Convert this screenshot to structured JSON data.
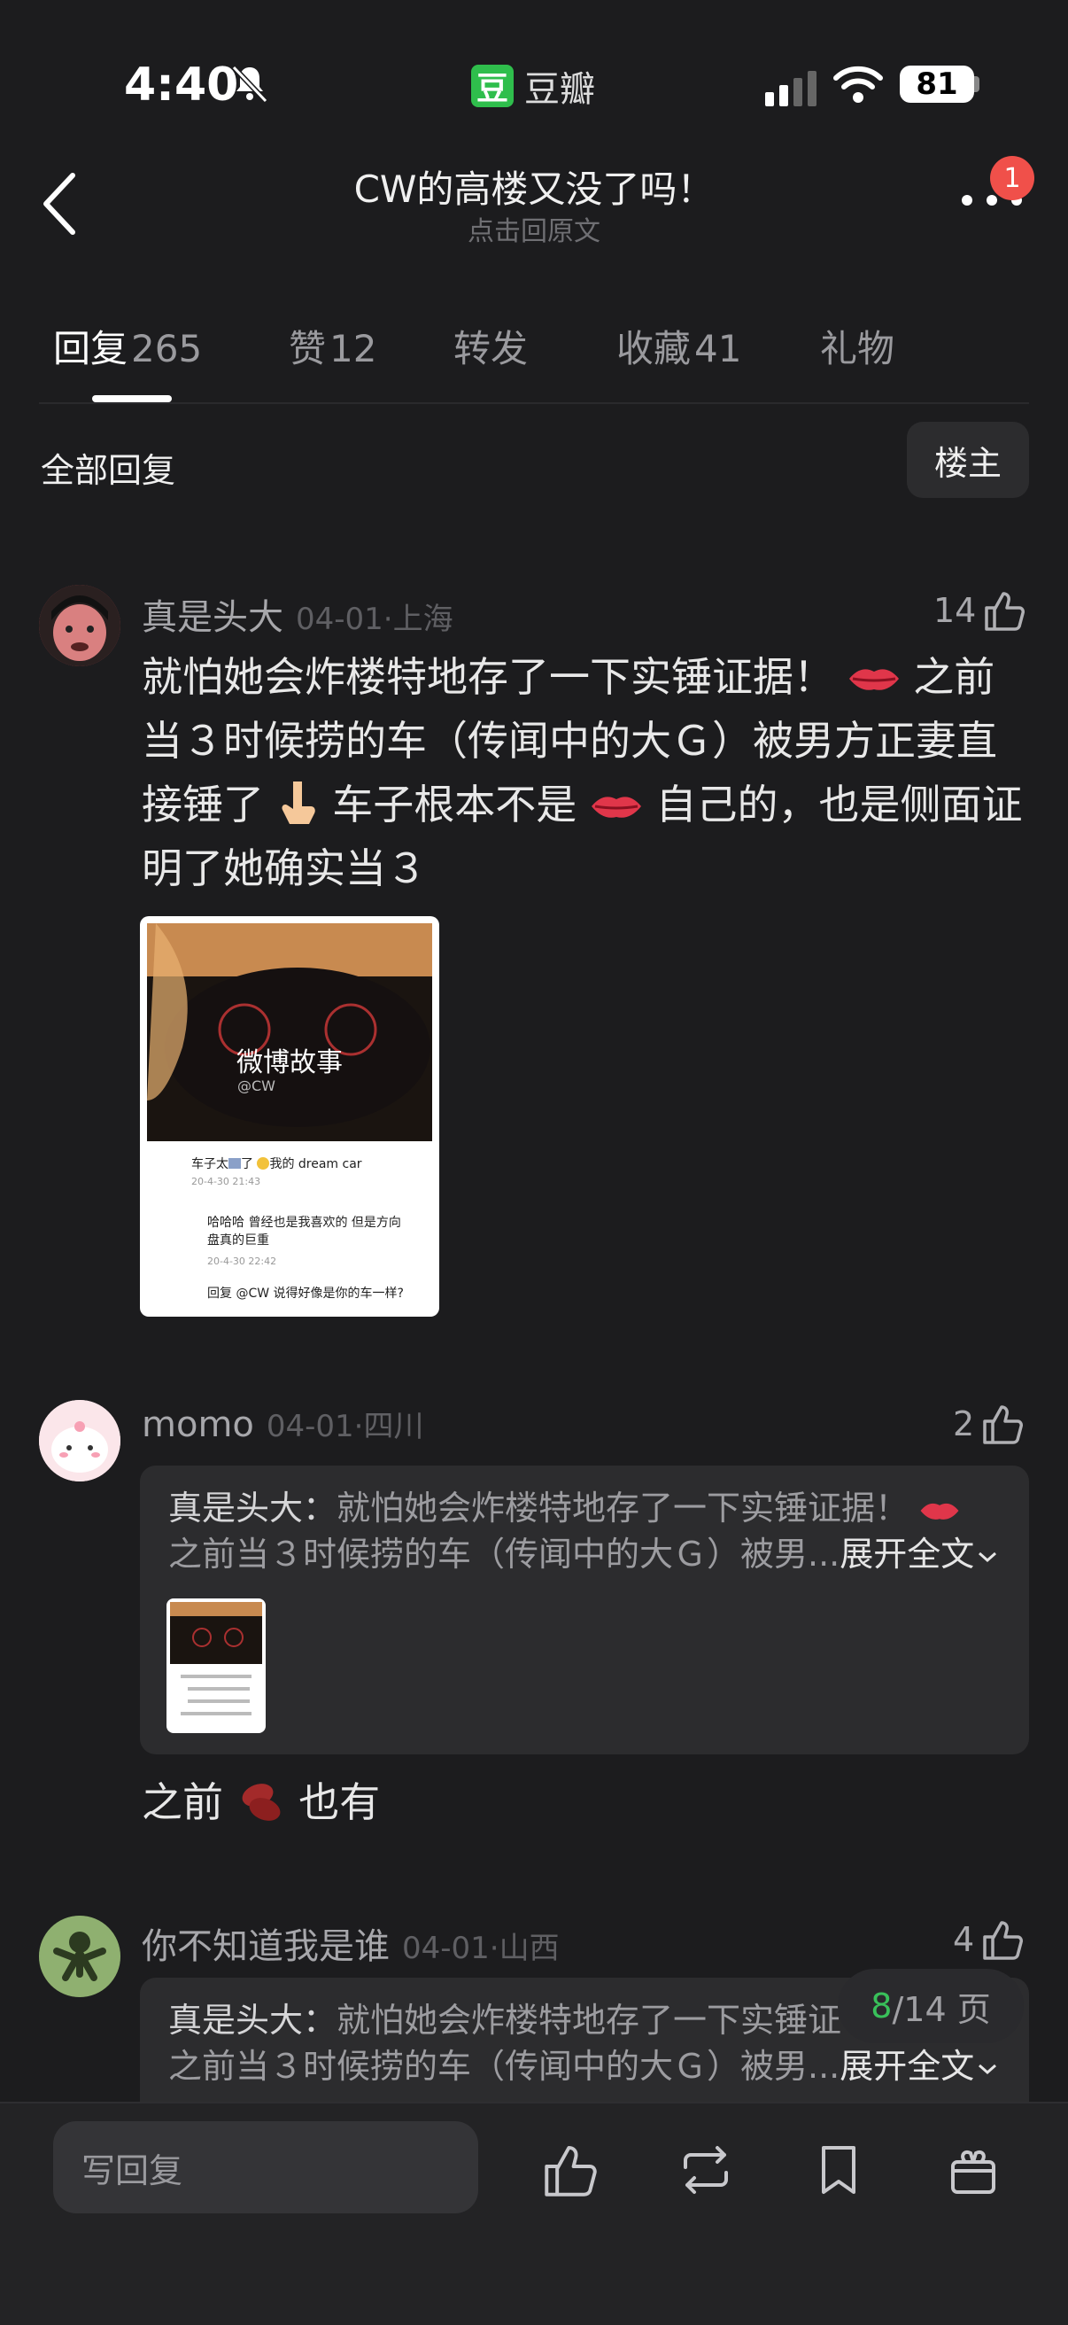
{
  "status_bar": {
    "time": "4:40",
    "app_name": "豆瓣",
    "app_logo_char": "豆",
    "battery": "81"
  },
  "header": {
    "title": "CW的高楼又没了吗！",
    "subtitle": "点击回原文",
    "notification_count": "1"
  },
  "tabs": [
    {
      "label": "回复",
      "count": "265",
      "active": true
    },
    {
      "label": "赞",
      "count": "12"
    },
    {
      "label": "转发",
      "count": ""
    },
    {
      "label": "收藏",
      "count": "41"
    },
    {
      "label": "礼物",
      "count": ""
    }
  ],
  "section": {
    "label": "全部回复",
    "filter": "楼主"
  },
  "comments": [
    {
      "user": "真是头大",
      "date": "04-01",
      "location": "上海",
      "likes": "14",
      "text_parts": [
        "就怕她会炸楼特地存了一下实锤证据！",
        "之前当３时候捞的车（传闻中的大Ｇ）被男方正妻直接锤了",
        "车子根本不是",
        "自己的，也是侧面证明了她确实当３"
      ],
      "image": {
        "caption": "微博故事",
        "handle": "@CW",
        "c1": "车子太",
        "c1b": "了",
        "c1c": "我的 dream car",
        "c1_time": "20-4-30 21:43",
        "c2": "哈哈哈 曾经也是我喜欢的 但是方向盘真的巨重",
        "c2_time": "20-4-30 22:42",
        "c3": "回复 @CW",
        "c3b": "说得好像是你的车一样?"
      }
    },
    {
      "user": "momo",
      "date": "04-01",
      "location": "四川",
      "likes": "2",
      "quote_author": "真是头大：",
      "quote_text": "就怕她会炸楼特地存了一下实锤证据！",
      "quote_text2": "之前当３时候捞的车（传闻中的大Ｇ）被男...",
      "expand": "展开全文",
      "text_a": "之前",
      "text_b": "也有"
    },
    {
      "user": "你不知道我是谁",
      "date": "04-01",
      "location": "山西",
      "likes": "4",
      "quote_author": "真是头大：",
      "quote_text": "就怕她会炸楼特地存了一下实锤证",
      "quote_text2": "之前当３时候捞的车（传闻中的大Ｇ）被男...",
      "expand": "展开全文"
    }
  ],
  "pager": {
    "current": "8",
    "total": "/14 页"
  },
  "bottom_bar": {
    "reply_placeholder": "写回复"
  },
  "colors": {
    "background": "#1c1c1e",
    "accent_green": "#39c05a",
    "badge_red": "#f0504a"
  }
}
